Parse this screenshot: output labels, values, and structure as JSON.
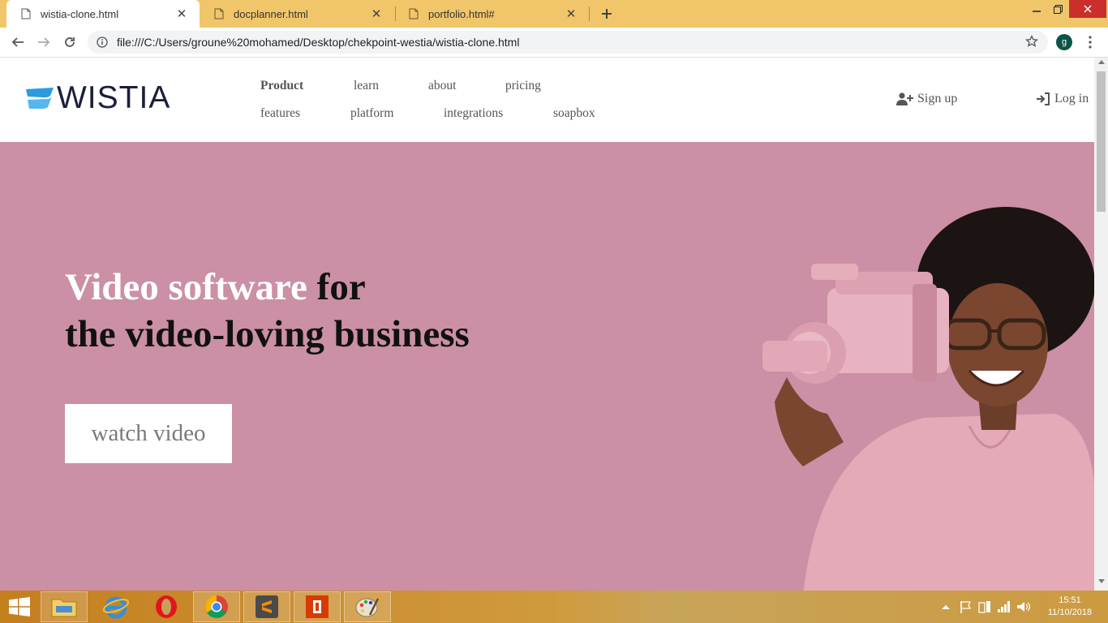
{
  "browser": {
    "tabs": [
      {
        "title": "wistia-clone.html",
        "active": true
      },
      {
        "title": "docplanner.html",
        "active": false
      },
      {
        "title": "portfolio.html#",
        "active": false
      }
    ],
    "url": "file:///C:/Users/groune%20mohamed/Desktop/chekpoint-westia/wistia-clone.html",
    "profile_initial": "g",
    "colors": {
      "tab_strip": "#f1c66a",
      "profile": "#0b5547"
    }
  },
  "site": {
    "logo": {
      "wordmark": "WISTIA",
      "accent_color": "#2a9be0"
    },
    "nav": {
      "row1": [
        "Product",
        "learn",
        "about",
        "pricing"
      ],
      "row2": [
        "features",
        "platform",
        "integrations",
        "soapbox"
      ]
    },
    "auth": {
      "signup": "Sign up",
      "login": "Log in"
    },
    "hero": {
      "headline_light": "Video software",
      "headline_dark_1": " for",
      "headline_dark_2": "the video-loving business",
      "cta": "watch video",
      "background": "#cb90a5"
    }
  },
  "taskbar": {
    "apps": [
      "file-explorer",
      "internet-explorer",
      "opera",
      "chrome",
      "sublime-text",
      "office",
      "paint"
    ],
    "clock": {
      "time": "15:51",
      "date": "11/10/2018"
    }
  }
}
